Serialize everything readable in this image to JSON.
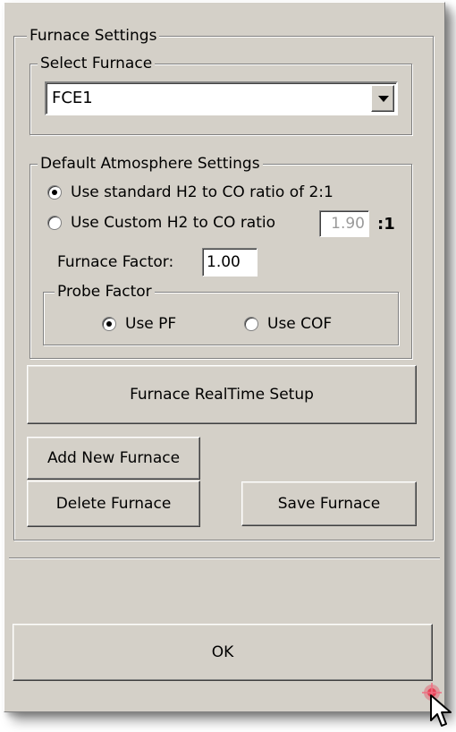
{
  "furnace_settings": {
    "title": "Furnace Settings",
    "select_furnace": {
      "title": "Select Furnace",
      "selected": "FCE1"
    },
    "default_atmosphere": {
      "title": "Default Atmosphere Settings",
      "option_standard": "Use standard H2 to CO ratio of 2:1",
      "option_custom": "Use Custom H2 to CO ratio",
      "custom_ratio_value": "1.90",
      "ratio_suffix": ":1",
      "furnace_factor_label": "Furnace Factor:",
      "furnace_factor_value": "1.00",
      "probe_factor": {
        "title": "Probe Factor",
        "option_pf": "Use PF",
        "option_cof": "Use COF"
      }
    },
    "buttons": {
      "realtime_setup": "Furnace RealTime Setup",
      "add_new": "Add New Furnace",
      "delete": "Delete Furnace",
      "save": "Save Furnace"
    }
  },
  "ok_button": "OK",
  "colors": {
    "face": "#d4d0c8",
    "shadow": "#808080",
    "highlight": "#ffffff",
    "disabled_text": "#9a9a9a",
    "sparkle": "#e8324a"
  }
}
